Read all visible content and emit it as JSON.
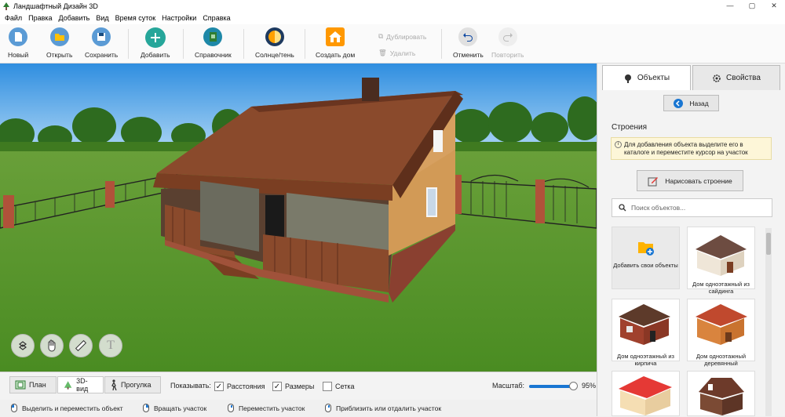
{
  "window": {
    "title": "Ландшафтный Дизайн 3D",
    "min": "—",
    "max": "▢",
    "close": "✕"
  },
  "menu": [
    "Файл",
    "Правка",
    "Добавить",
    "Вид",
    "Время суток",
    "Настройки",
    "Справка"
  ],
  "toolbar": {
    "new": "Новый",
    "open": "Открыть",
    "save": "Сохранить",
    "add": "Добавить",
    "reference": "Справочник",
    "sun": "Солнце/тень",
    "build_house": "Создать дом",
    "duplicate": "Дублировать",
    "delete": "Удалить",
    "undo": "Отменить",
    "redo": "Повторить"
  },
  "viewtabs": {
    "plan": "План",
    "view3d": "3D-вид",
    "walk": "Прогулка"
  },
  "show": {
    "label": "Показывать:",
    "distances": "Расстояния",
    "sizes": "Размеры",
    "grid": "Сетка",
    "distances_checked": true,
    "sizes_checked": true,
    "grid_checked": false
  },
  "zoom": {
    "label": "Масштаб:",
    "value": "95%",
    "fraction": 0.95
  },
  "status": {
    "select": "Выделить и переместить объект",
    "rotate": "Вращать участок",
    "move": "Переместить участок",
    "zoom": "Приблизить или отдалить участок"
  },
  "panel": {
    "tab_objects": "Объекты",
    "tab_properties": "Свойства",
    "back": "Назад",
    "section": "Строения",
    "hint": "Для добавления объекта выделите его в каталоге и переместите курсор на участок",
    "draw": "Нарисовать строение",
    "search_placeholder": "Поиск объектов...",
    "items": [
      "Добавить свои объекты",
      "Дом одноэтажный из сайдинга",
      "Дом одноэтажный из кирпича",
      "Дом одноэтажный деревянный"
    ]
  },
  "colors": {
    "accent": "#1976d2",
    "add_green": "#26a69a",
    "sun_orange": "#ff9800"
  }
}
